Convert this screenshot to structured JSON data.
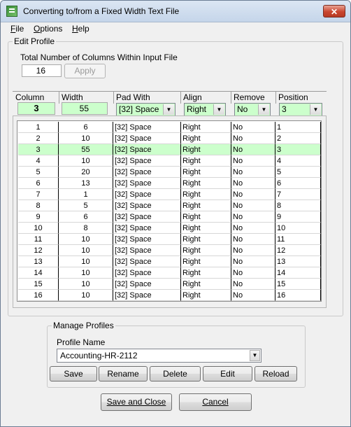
{
  "window": {
    "title": "Converting to/from a Fixed Width Text File",
    "close_glyph": "✕"
  },
  "menu": [
    {
      "mnemonic": "F",
      "rest": "ile"
    },
    {
      "mnemonic": "O",
      "rest": "ptions"
    },
    {
      "mnemonic": "H",
      "rest": "elp"
    }
  ],
  "edit_profile": {
    "group_title": "Edit Profile",
    "total_columns_label": "Total Number of Columns Within Input File",
    "total_columns_value": "16",
    "apply_label": "Apply"
  },
  "column_editor": {
    "headers": {
      "column": "Column",
      "width": "Width",
      "pad_with": "Pad With",
      "align": "Align",
      "remove": "Remove",
      "position": "Position"
    },
    "current": {
      "column": "3",
      "width": "55",
      "pad_with": "[32] Space",
      "align": "Right",
      "remove": "No",
      "position": "3"
    }
  },
  "grid": {
    "selected_row": 3,
    "rows": [
      [
        "1",
        "6",
        "[32] Space",
        "Right",
        "No",
        "1"
      ],
      [
        "2",
        "10",
        "[32] Space",
        "Right",
        "No",
        "2"
      ],
      [
        "3",
        "55",
        "[32] Space",
        "Right",
        "No",
        "3"
      ],
      [
        "4",
        "10",
        "[32] Space",
        "Right",
        "No",
        "4"
      ],
      [
        "5",
        "20",
        "[32] Space",
        "Right",
        "No",
        "5"
      ],
      [
        "6",
        "13",
        "[32] Space",
        "Right",
        "No",
        "6"
      ],
      [
        "7",
        "1",
        "[32] Space",
        "Right",
        "No",
        "7"
      ],
      [
        "8",
        "5",
        "[32] Space",
        "Right",
        "No",
        "8"
      ],
      [
        "9",
        "6",
        "[32] Space",
        "Right",
        "No",
        "9"
      ],
      [
        "10",
        "8",
        "[32] Space",
        "Right",
        "No",
        "10"
      ],
      [
        "11",
        "10",
        "[32] Space",
        "Right",
        "No",
        "11"
      ],
      [
        "12",
        "10",
        "[32] Space",
        "Right",
        "No",
        "12"
      ],
      [
        "13",
        "10",
        "[32] Space",
        "Right",
        "No",
        "13"
      ],
      [
        "14",
        "10",
        "[32] Space",
        "Right",
        "No",
        "14"
      ],
      [
        "15",
        "10",
        "[32] Space",
        "Right",
        "No",
        "15"
      ],
      [
        "16",
        "10",
        "[32] Space",
        "Right",
        "No",
        "16"
      ]
    ]
  },
  "manage_profiles": {
    "group_title": "Manage Profiles",
    "profile_name_label": "Profile Name",
    "profile_name_value": "Accounting-HR-2112",
    "buttons": {
      "save": "Save",
      "rename": "Rename",
      "delete": "Delete",
      "edit": "Edit",
      "reload": "Reload"
    }
  },
  "footer": {
    "save_close_label": "Save and Close",
    "cancel_label": "Cancel"
  },
  "colors": {
    "highlight_green": "#ccffcc",
    "close_red": "#c9452e"
  }
}
